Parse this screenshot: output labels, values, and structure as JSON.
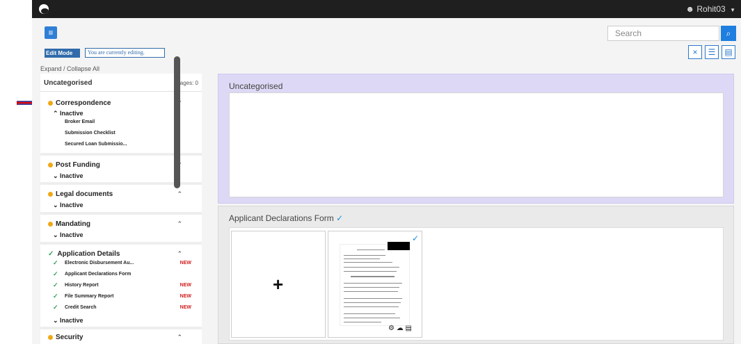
{
  "header": {
    "user": "Rohit03"
  },
  "toolbar": {
    "edit_mode": "Edit Mode",
    "editing_notice": "You are currently editing.",
    "search_placeholder": "Search"
  },
  "sidebar": {
    "expand": "Expand / Collapse All",
    "title": "Uncategorised",
    "pages": "Pages: 0",
    "groups": [
      {
        "name": "Correspondence",
        "inactive": "Inactive",
        "items": [
          "Broker Email",
          "Submission Checklist",
          "Secured Loan Submissio..."
        ]
      },
      {
        "name": "Post Funding",
        "inactive": "Inactive"
      },
      {
        "name": "Legal documents",
        "inactive": "Inactive"
      },
      {
        "name": "Mandating",
        "inactive": "Inactive"
      },
      {
        "name": "Application Details",
        "inactive": "Inactive",
        "items": [
          {
            "label": "Electronic Disbursement Au...",
            "badge": "NEW"
          },
          {
            "label": "Applicant Declarations Form",
            "badge": ""
          },
          {
            "label": "History Report",
            "badge": "NEW"
          },
          {
            "label": "File Summary Report",
            "badge": "NEW"
          },
          {
            "label": "Credit Search",
            "badge": "NEW"
          }
        ]
      },
      {
        "name": "Security"
      }
    ]
  },
  "main": {
    "panel1_title": "Uncategorised",
    "panel2_title": "Applicant Declarations Form"
  },
  "colors": {
    "accent": "#2f7fd6",
    "new": "#d01e1e",
    "check": "#36a05d",
    "warning": "#f0a817"
  }
}
